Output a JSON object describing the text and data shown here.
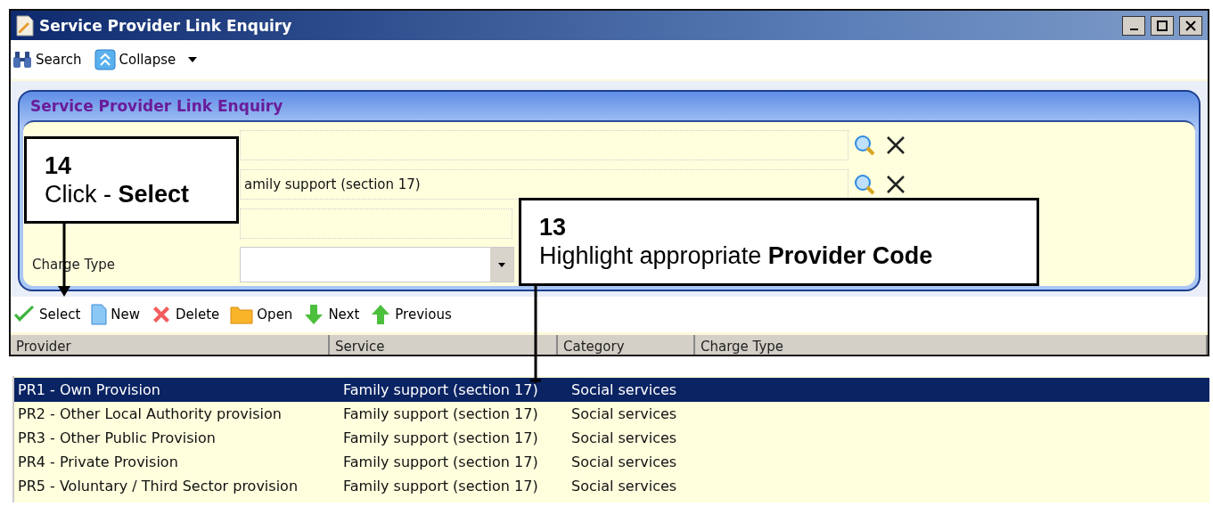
{
  "window": {
    "title": "Service Provider Link Enquiry"
  },
  "toolbar": [
    {
      "kind": "search",
      "label": "Search"
    },
    {
      "kind": "collapse",
      "label": "Collapse"
    }
  ],
  "panel": {
    "title": "Service Provider Link Enquiry",
    "fields": [
      {
        "kind": "lookup"
      },
      {
        "kind": "lookup",
        "value": "amily  support (section 17)"
      },
      {
        "kind": "readonly"
      },
      {
        "kind": "dropdown",
        "label": "Charge Type"
      }
    ]
  },
  "actions": [
    {
      "kind": "select",
      "label": "Select"
    },
    {
      "kind": "new",
      "label": "New"
    },
    {
      "kind": "delete",
      "label": "Delete"
    },
    {
      "kind": "open",
      "label": "Open"
    },
    {
      "kind": "next",
      "label": "Next"
    },
    {
      "kind": "previous",
      "label": "Previous"
    }
  ],
  "table": {
    "columns": [
      "Provider",
      "Service",
      "Category",
      "Charge Type"
    ],
    "rows": [
      {
        "selected": true,
        "cells": [
          "PR1 - Own Provision",
          "Family support (section 17)",
          "Social services"
        ]
      },
      {
        "selected": false,
        "cells": [
          "PR2 - Other Local Authority provision",
          "Family support (section 17)",
          "Social services"
        ]
      },
      {
        "selected": false,
        "cells": [
          "PR3 - Other Public Provision",
          "Family support (section 17)",
          "Social services"
        ]
      },
      {
        "selected": false,
        "cells": [
          "PR4 - Private Provision",
          "Family support (section 17)",
          "Social services"
        ]
      },
      {
        "selected": false,
        "cells": [
          "PR5 - Voluntary / Third Sector provision",
          "Family support (section 17)",
          "Social services"
        ]
      }
    ]
  },
  "callouts": [
    {
      "number": "14",
      "text": "Click - **Select**"
    },
    {
      "number": "13",
      "text": "Highlight appropriate **Provider Code**"
    }
  ]
}
